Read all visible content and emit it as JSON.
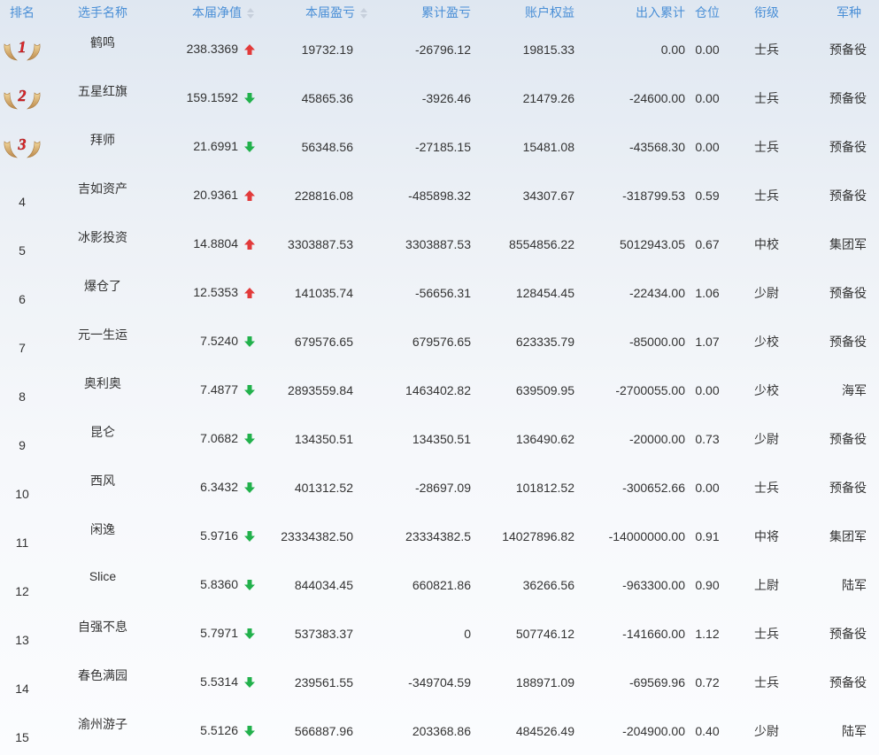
{
  "headers": {
    "rank": "排名",
    "name": "选手名称",
    "nav": "本届净值",
    "pnl": "本届盈亏",
    "cum_pnl": "累计盈亏",
    "equity": "账户权益",
    "flow": "出入累计",
    "position": "仓位",
    "grade": "衔级",
    "branch": "军种"
  },
  "colors": {
    "header": "#4a8fd6",
    "up": "#e23a3a",
    "down": "#22b14c",
    "medal": "#d4a050"
  },
  "rows": [
    {
      "rank": "1",
      "medal": "medal-1-icon",
      "name": "鹤鸣",
      "nav": "238.3369",
      "trend": "up",
      "pnl": "19732.19",
      "cum": "-26796.12",
      "equity": "19815.33",
      "flow": "0.00",
      "pos": "0.00",
      "grade": "士兵",
      "branch": "预备役"
    },
    {
      "rank": "2",
      "medal": "medal-2-icon",
      "name": "五星红旗",
      "nav": "159.1592",
      "trend": "down",
      "pnl": "45865.36",
      "cum": "-3926.46",
      "equity": "21479.26",
      "flow": "-24600.00",
      "pos": "0.00",
      "grade": "士兵",
      "branch": "预备役"
    },
    {
      "rank": "3",
      "medal": "medal-3-icon",
      "name": "拜师",
      "nav": "21.6991",
      "trend": "down",
      "pnl": "56348.56",
      "cum": "-27185.15",
      "equity": "15481.08",
      "flow": "-43568.30",
      "pos": "0.00",
      "grade": "士兵",
      "branch": "预备役"
    },
    {
      "rank": "4",
      "name": "吉如资产",
      "nav": "20.9361",
      "trend": "up",
      "pnl": "228816.08",
      "cum": "-485898.32",
      "equity": "34307.67",
      "flow": "-318799.53",
      "pos": "0.59",
      "grade": "士兵",
      "branch": "预备役"
    },
    {
      "rank": "5",
      "name": "冰影投资",
      "nav": "14.8804",
      "trend": "up",
      "pnl": "3303887.53",
      "cum": "3303887.53",
      "equity": "8554856.22",
      "flow": "5012943.05",
      "pos": "0.67",
      "grade": "中校",
      "branch": "集团军"
    },
    {
      "rank": "6",
      "name": "爆仓了",
      "nav": "12.5353",
      "trend": "up",
      "pnl": "141035.74",
      "cum": "-56656.31",
      "equity": "128454.45",
      "flow": "-22434.00",
      "pos": "1.06",
      "grade": "少尉",
      "branch": "预备役"
    },
    {
      "rank": "7",
      "name": "元一生运",
      "nav": "7.5240",
      "trend": "down",
      "pnl": "679576.65",
      "cum": "679576.65",
      "equity": "623335.79",
      "flow": "-85000.00",
      "pos": "1.07",
      "grade": "少校",
      "branch": "预备役"
    },
    {
      "rank": "8",
      "name": "奥利奥",
      "nav": "7.4877",
      "trend": "down",
      "pnl": "2893559.84",
      "cum": "1463402.82",
      "equity": "639509.95",
      "flow": "-2700055.00",
      "pos": "0.00",
      "grade": "少校",
      "branch": "海军"
    },
    {
      "rank": "9",
      "name": "昆仑",
      "nav": "7.0682",
      "trend": "down",
      "pnl": "134350.51",
      "cum": "134350.51",
      "equity": "136490.62",
      "flow": "-20000.00",
      "pos": "0.73",
      "grade": "少尉",
      "branch": "预备役"
    },
    {
      "rank": "10",
      "name": "西风",
      "nav": "6.3432",
      "trend": "down",
      "pnl": "401312.52",
      "cum": "-28697.09",
      "equity": "101812.52",
      "flow": "-300652.66",
      "pos": "0.00",
      "grade": "士兵",
      "branch": "预备役"
    },
    {
      "rank": "11",
      "name": "闲逸",
      "nav": "5.9716",
      "trend": "down",
      "pnl": "23334382.50",
      "cum": "23334382.5",
      "equity": "14027896.82",
      "flow": "-14000000.00",
      "pos": "0.91",
      "grade": "中将",
      "branch": "集团军"
    },
    {
      "rank": "12",
      "name": "Slice",
      "nav": "5.8360",
      "trend": "down",
      "pnl": "844034.45",
      "cum": "660821.86",
      "equity": "36266.56",
      "flow": "-963300.00",
      "pos": "0.90",
      "grade": "上尉",
      "branch": "陆军"
    },
    {
      "rank": "13",
      "name": "自强不息",
      "nav": "5.7971",
      "trend": "down",
      "pnl": "537383.37",
      "cum": "0",
      "equity": "507746.12",
      "flow": "-141660.00",
      "pos": "1.12",
      "grade": "士兵",
      "branch": "预备役"
    },
    {
      "rank": "14",
      "name": "春色满园",
      "nav": "5.5314",
      "trend": "down",
      "pnl": "239561.55",
      "cum": "-349704.59",
      "equity": "188971.09",
      "flow": "-69569.96",
      "pos": "0.72",
      "grade": "士兵",
      "branch": "预备役"
    },
    {
      "rank": "15",
      "name": "渝州游子",
      "nav": "5.5126",
      "trend": "down",
      "pnl": "566887.96",
      "cum": "203368.86",
      "equity": "484526.49",
      "flow": "-204900.00",
      "pos": "0.40",
      "grade": "少尉",
      "branch": "陆军"
    }
  ]
}
